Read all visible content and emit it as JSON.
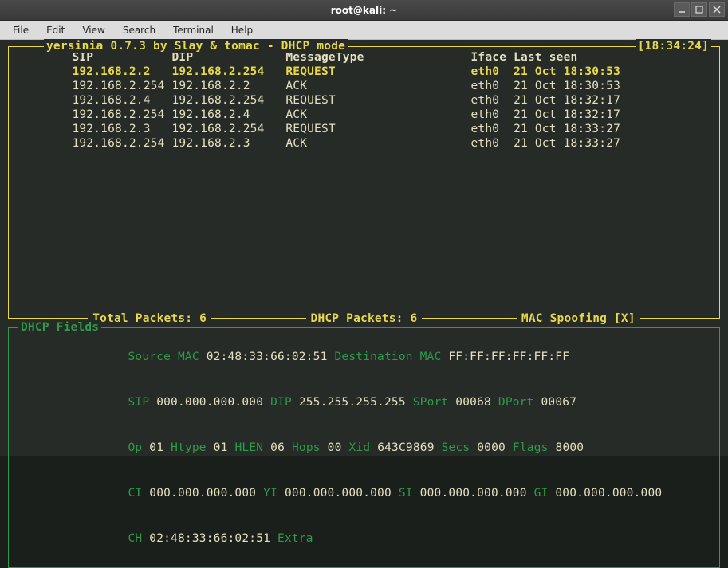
{
  "window": {
    "title": "root@kali: ~"
  },
  "menu": [
    "File",
    "Edit",
    "View",
    "Search",
    "Terminal",
    "Help"
  ],
  "top_box": {
    "title": "yersinia 0.7.3 by Slay & tomac - DHCP mode",
    "clock": "[18:34:24]",
    "headers": {
      "sip": "SIP",
      "dip": "DIP",
      "msg": "MessageType",
      "iface": "Iface",
      "last": "Last seen"
    },
    "rows": [
      {
        "sip": "192.168.2.2",
        "dip": "192.168.2.254",
        "msg": "REQUEST",
        "iface": "eth0",
        "last": "21 Oct 18:30:53",
        "sel": true
      },
      {
        "sip": "192.168.2.254",
        "dip": "192.168.2.2",
        "msg": "ACK",
        "iface": "eth0",
        "last": "21 Oct 18:30:53",
        "sel": false
      },
      {
        "sip": "192.168.2.4",
        "dip": "192.168.2.254",
        "msg": "REQUEST",
        "iface": "eth0",
        "last": "21 Oct 18:32:17",
        "sel": false
      },
      {
        "sip": "192.168.2.254",
        "dip": "192.168.2.4",
        "msg": "ACK",
        "iface": "eth0",
        "last": "21 Oct 18:32:17",
        "sel": false
      },
      {
        "sip": "192.168.2.3",
        "dip": "192.168.2.254",
        "msg": "REQUEST",
        "iface": "eth0",
        "last": "21 Oct 18:33:27",
        "sel": false
      },
      {
        "sip": "192.168.2.254",
        "dip": "192.168.2.3",
        "msg": "ACK",
        "iface": "eth0",
        "last": "21 Oct 18:33:27",
        "sel": false
      }
    ],
    "footer": {
      "total": "Total Packets: 6",
      "dhcp": "DHCP Packets: 6",
      "mac": "MAC Spoofing [X]"
    }
  },
  "bottom_box": {
    "title": "DHCP Fields",
    "fields": {
      "src_mac_label": "Source MAC",
      "src_mac": "02:48:33:66:02:51",
      "dst_mac_label": "Destination MAC",
      "dst_mac": "FF:FF:FF:FF:FF:FF",
      "sip_label": "SIP",
      "sip": "000.000.000.000",
      "dip_label": "DIP",
      "dip": "255.255.255.255",
      "sport_label": "SPort",
      "sport": "00068",
      "dport_label": "DPort",
      "dport": "00067",
      "op_label": "Op",
      "op": "01",
      "htype_label": "Htype",
      "htype": "01",
      "hlen_label": "HLEN",
      "hlen": "06",
      "hops_label": "Hops",
      "hops": "00",
      "xid_label": "Xid",
      "xid": "643C9869",
      "secs_label": "Secs",
      "secs": "0000",
      "flags_label": "Flags",
      "flags": "8000",
      "ci_label": "CI",
      "ci": "000.000.000.000",
      "yi_label": "YI",
      "yi": "000.000.000.000",
      "si_label": "SI",
      "si": "000.000.000.000",
      "gi_label": "GI",
      "gi": "000.000.000.000",
      "ch_label": "CH",
      "ch": "02:48:33:66:02:51",
      "extra_label": "Extra"
    }
  }
}
